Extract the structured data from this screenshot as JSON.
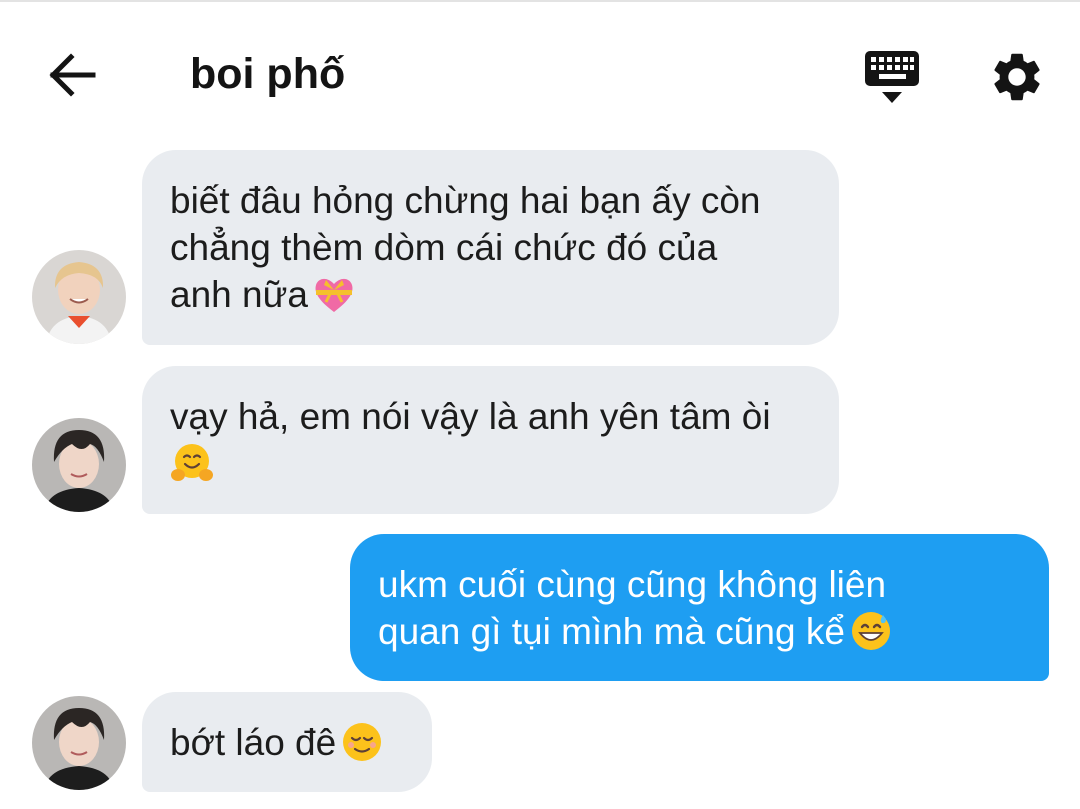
{
  "header": {
    "title": "boi phố",
    "back_icon": "arrow-left-icon",
    "keyboard_icon": "keyboard-hide-icon",
    "settings_icon": "gear-icon"
  },
  "colors": {
    "incoming_bubble": "#e9ecf0",
    "outgoing_bubble": "#1e9ef2",
    "title_text": "#141414"
  },
  "messages": [
    {
      "direction": "incoming",
      "avatar": "avatar-blond-boy",
      "lines": [
        "biết đâu hỏng chừng hai bạn ấy còn",
        "chẳng thèm dòm cái chức đó của",
        "anh nữa"
      ],
      "emoji": "heart-with-ribbon-icon"
    },
    {
      "direction": "incoming",
      "avatar": "avatar-dark-hair-boy",
      "lines": [
        "vạy hả, em nói vậy là anh yên tâm òi"
      ],
      "emoji": "hugging-face-icon"
    },
    {
      "direction": "outgoing",
      "lines": [
        "ukm cuối cùng cũng không liên",
        "quan gì tụi mình mà cũng kể"
      ],
      "emoji": "grinning-sweat-icon"
    },
    {
      "direction": "incoming",
      "avatar": "avatar-dark-hair-boy",
      "lines": [
        "bớt láo đê"
      ],
      "emoji": "relieved-face-icon"
    }
  ]
}
